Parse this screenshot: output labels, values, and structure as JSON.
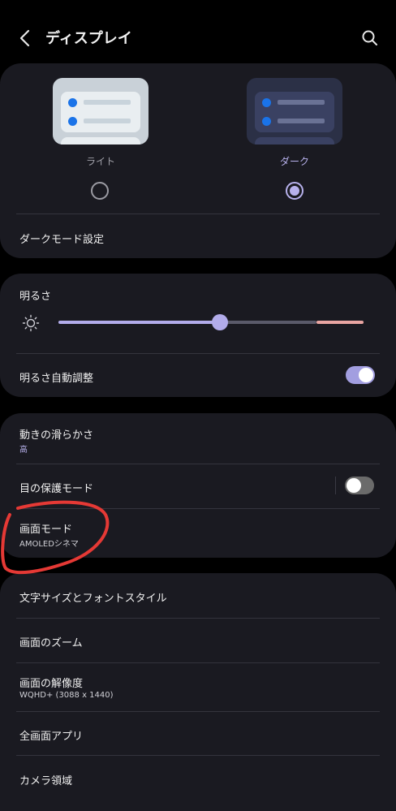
{
  "header": {
    "title": "ディスプレイ"
  },
  "theme": {
    "light_label": "ライト",
    "dark_label": "ダーク",
    "selected": "dark",
    "dark_mode_settings": "ダークモード設定"
  },
  "brightness": {
    "label": "明るさ",
    "level": 0.53,
    "auto_label": "明るさ自動調整",
    "auto_on": true
  },
  "misc": {
    "motion_smoothness_label": "動きの滑らかさ",
    "motion_smoothness_value": "高",
    "eye_comfort_label": "目の保護モード",
    "eye_comfort_on": false,
    "screen_mode_label": "画面モード",
    "screen_mode_value": "AMOLEDシネマ"
  },
  "more": {
    "font_size_style": "文字サイズとフォントスタイル",
    "screen_zoom": "画面のズーム",
    "resolution_label": "画面の解像度",
    "resolution_value": "WQHD+ (3088 x 1440)",
    "full_screen_apps": "全画面アプリ",
    "camera_cutout": "カメラ領域"
  },
  "colors": {
    "accent": "#b2acea",
    "card_bg": "#1a1a21",
    "annotation": "#e53935"
  }
}
